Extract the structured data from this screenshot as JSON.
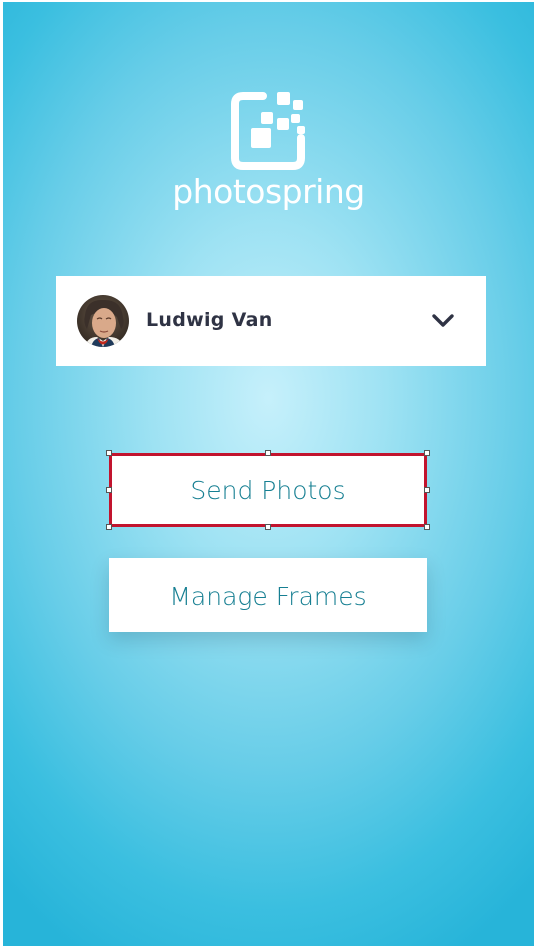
{
  "app": {
    "brand_name": "photospring"
  },
  "account_selector": {
    "user_name": "Ludwig Van",
    "avatar_icon": "user-portrait-avatar",
    "dropdown_icon": "chevron-down-icon"
  },
  "actions": {
    "send_photos_label": "Send Photos",
    "manage_frames_label": "Manage Frames"
  },
  "colors": {
    "background_center": "#c6f0fb",
    "background_edge": "#27b4d9",
    "button_text": "#167f92",
    "name_text": "#2f3344",
    "selection_outline": "#c2142e"
  }
}
